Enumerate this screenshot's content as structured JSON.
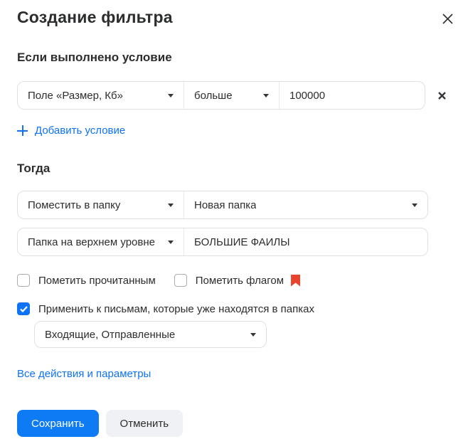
{
  "dialog": {
    "title": "Создание фильтра"
  },
  "condition_section": {
    "heading": "Если выполнено условие",
    "row": {
      "field_select": "Поле «Размер, Кб»",
      "operator_select": "больше",
      "value_input": "100000"
    },
    "add_condition_link": "Добавить условие"
  },
  "action_section": {
    "heading": "Тогда",
    "action_row": {
      "action_select": "Поместить в папку",
      "folder_select": "Новая папка"
    },
    "folder_row": {
      "level_select": "Папка на верхнем уровне",
      "folder_name_input": "БОЛЬШИЕ ФАИЛЫ"
    },
    "checkboxes": {
      "mark_read": {
        "label": "Пометить прочитанным",
        "checked": false
      },
      "mark_flag": {
        "label": "Пометить флагом",
        "checked": false
      },
      "apply_existing": {
        "label": "Применить к письмам, которые уже находятся в папках",
        "checked": true
      }
    },
    "apply_folders_select": "Входящие, Отправленные"
  },
  "links": {
    "all_actions": "Все действия и параметры"
  },
  "footer": {
    "save_label": "Сохранить",
    "cancel_label": "Отменить"
  },
  "colors": {
    "accent_blue": "#0e73f6",
    "save_button_blue": "#0e7bf5",
    "flag_red": "#e8432d",
    "text_primary": "#2c2d2e",
    "row_border": "#dfe1e6",
    "cancel_button_bg": "#f0f1f4"
  }
}
